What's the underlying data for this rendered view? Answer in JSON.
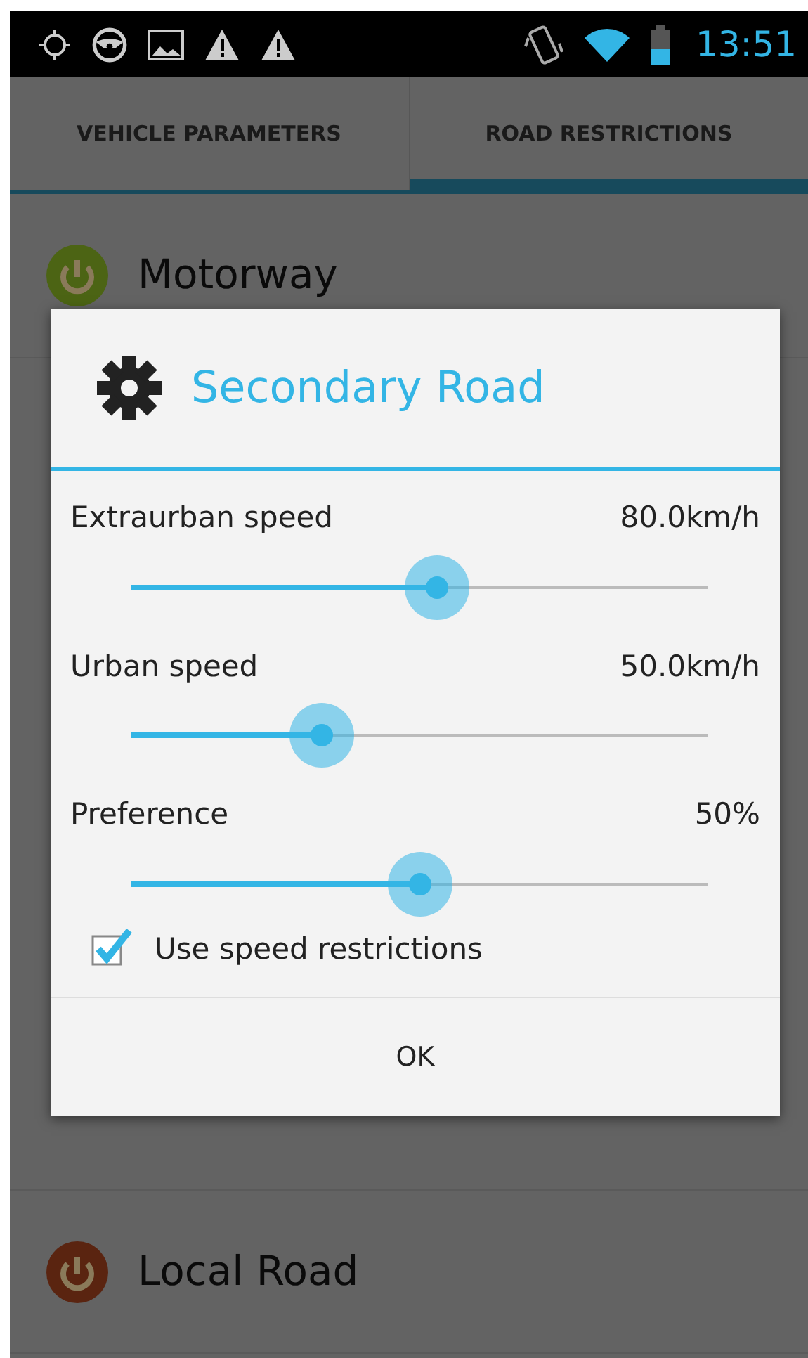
{
  "status_bar": {
    "time": "13:51"
  },
  "tabs": [
    {
      "label": "VEHICLE PARAMETERS",
      "selected": false
    },
    {
      "label": "ROAD RESTRICTIONS",
      "selected": true
    }
  ],
  "roads": [
    {
      "name": "Motorway",
      "color": "#4c6414"
    },
    {
      "name": "Local Road",
      "color": "#5a2410"
    }
  ],
  "dialog": {
    "title": "Secondary Road",
    "sliders": [
      {
        "label": "Extraurban speed",
        "reading": "80.0km/h",
        "level": 0.53
      },
      {
        "label": "Urban speed",
        "reading": "50.0km/h",
        "level": 0.33
      },
      {
        "label": "Preference",
        "reading": "50%",
        "level": 0.5
      }
    ],
    "checkbox": {
      "label": "Use speed restrictions",
      "checked": true
    },
    "button": "OK"
  }
}
